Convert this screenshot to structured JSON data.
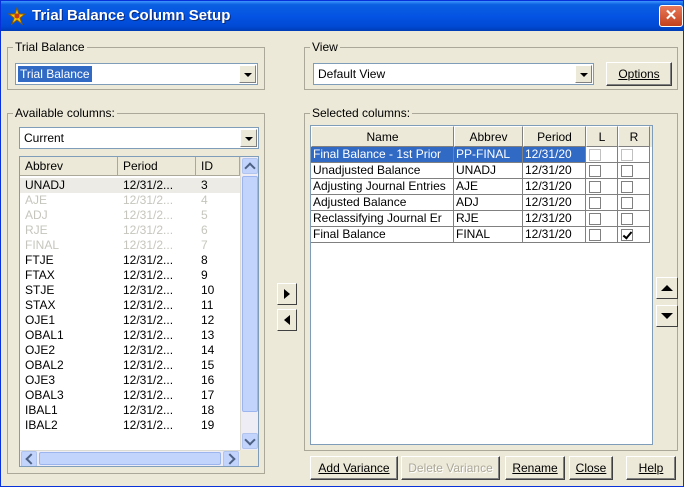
{
  "window": {
    "title": "Trial Balance Column Setup"
  },
  "trial_balance": {
    "group_label": "Trial Balance",
    "selected": "Trial Balance"
  },
  "view": {
    "group_label": "View",
    "selected": "Default View",
    "options_label": "Options"
  },
  "available": {
    "label": "Available columns:",
    "filter": "Current",
    "headers": [
      "Abbrev",
      "Period",
      "ID"
    ],
    "rows": [
      {
        "abbrev": "UNADJ",
        "period": "12/31/2...",
        "id": "3",
        "state": "highlight"
      },
      {
        "abbrev": "AJE",
        "period": "12/31/2...",
        "id": "4",
        "state": "dim"
      },
      {
        "abbrev": "ADJ",
        "period": "12/31/2...",
        "id": "5",
        "state": "dim"
      },
      {
        "abbrev": "RJE",
        "period": "12/31/2...",
        "id": "6",
        "state": "dim"
      },
      {
        "abbrev": "FINAL",
        "period": "12/31/2...",
        "id": "7",
        "state": "dim"
      },
      {
        "abbrev": "FTJE",
        "period": "12/31/2...",
        "id": "8",
        "state": "normal"
      },
      {
        "abbrev": "FTAX",
        "period": "12/31/2...",
        "id": "9",
        "state": "normal"
      },
      {
        "abbrev": "STJE",
        "period": "12/31/2...",
        "id": "10",
        "state": "normal"
      },
      {
        "abbrev": "STAX",
        "period": "12/31/2...",
        "id": "11",
        "state": "normal"
      },
      {
        "abbrev": "OJE1",
        "period": "12/31/2...",
        "id": "12",
        "state": "normal"
      },
      {
        "abbrev": "OBAL1",
        "period": "12/31/2...",
        "id": "13",
        "state": "normal"
      },
      {
        "abbrev": "OJE2",
        "period": "12/31/2...",
        "id": "14",
        "state": "normal"
      },
      {
        "abbrev": "OBAL2",
        "period": "12/31/2...",
        "id": "15",
        "state": "normal"
      },
      {
        "abbrev": "OJE3",
        "period": "12/31/2...",
        "id": "16",
        "state": "normal"
      },
      {
        "abbrev": "OBAL3",
        "period": "12/31/2...",
        "id": "17",
        "state": "normal"
      },
      {
        "abbrev": "IBAL1",
        "period": "12/31/2...",
        "id": "18",
        "state": "normal"
      },
      {
        "abbrev": "IBAL2",
        "period": "12/31/2...",
        "id": "19",
        "state": "normal"
      }
    ]
  },
  "selected": {
    "label": "Selected columns:",
    "headers": [
      "Name",
      "Abbrev",
      "Period",
      "L",
      "R"
    ],
    "rows": [
      {
        "name": "Final Balance - 1st Prior",
        "abbrev": "PP-FINAL",
        "period": "12/31/20",
        "l": false,
        "r": false,
        "selected": true
      },
      {
        "name": "Unadjusted Balance",
        "abbrev": "UNADJ",
        "period": "12/31/20",
        "l": false,
        "r": false,
        "selected": false
      },
      {
        "name": "Adjusting Journal Entries",
        "abbrev": "AJE",
        "period": "12/31/20",
        "l": false,
        "r": false,
        "selected": false
      },
      {
        "name": "Adjusted Balance",
        "abbrev": "ADJ",
        "period": "12/31/20",
        "l": false,
        "r": false,
        "selected": false
      },
      {
        "name": "Reclassifying Journal Er",
        "abbrev": "RJE",
        "period": "12/31/20",
        "l": false,
        "r": false,
        "selected": false
      },
      {
        "name": "Final Balance",
        "abbrev": "FINAL",
        "period": "12/31/20",
        "l": false,
        "r": true,
        "selected": false
      }
    ]
  },
  "buttons": {
    "add_variance": "Add Variance",
    "delete_variance": "Delete Variance",
    "rename": "Rename",
    "close": "Close",
    "help": "Help"
  },
  "colors": {
    "titlebar": "#0554e3",
    "selection": "#316ac5",
    "dialog_bg": "#ece9d8"
  }
}
